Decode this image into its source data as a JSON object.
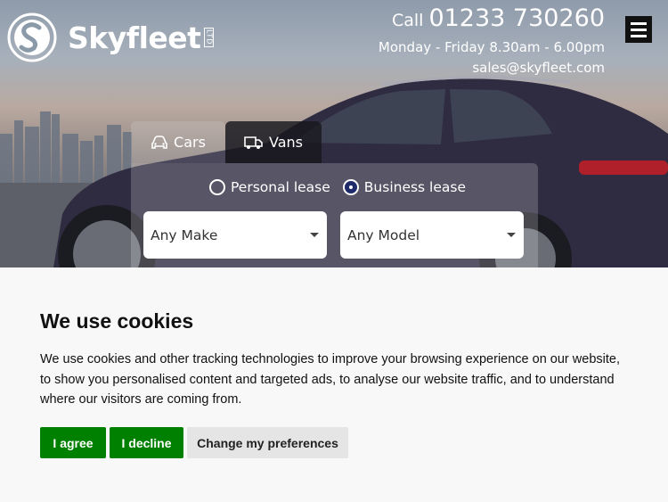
{
  "brand": {
    "name": "Skyfleet",
    "suffix": "LTD"
  },
  "contact": {
    "call_word": "Call",
    "phone": "01233 730260",
    "hours": "Monday - Friday 8.30am - 6.00pm",
    "email": "sales@skyfleet.com"
  },
  "search": {
    "tabs": [
      {
        "label": "Cars",
        "icon": "car-icon"
      },
      {
        "label": "Vans",
        "icon": "van-icon"
      }
    ],
    "lease_options": [
      {
        "label": "Personal lease",
        "selected": false
      },
      {
        "label": "Business lease",
        "selected": true
      }
    ],
    "make_select": "Any Make",
    "model_select": "Any Model"
  },
  "cookie_banner": {
    "title": "We use cookies",
    "body": "We use cookies and other tracking technologies to improve your browsing experience on our website, to show you personalised content and targeted ads, to analyse our website traffic, and to understand where our visitors are coming from.",
    "agree": "I agree",
    "decline": "I decline",
    "preferences": "Change my preferences"
  },
  "colors": {
    "accent_green": "#008000",
    "radio_selected": "#1f2a6b",
    "menu_bg": "#111111"
  }
}
